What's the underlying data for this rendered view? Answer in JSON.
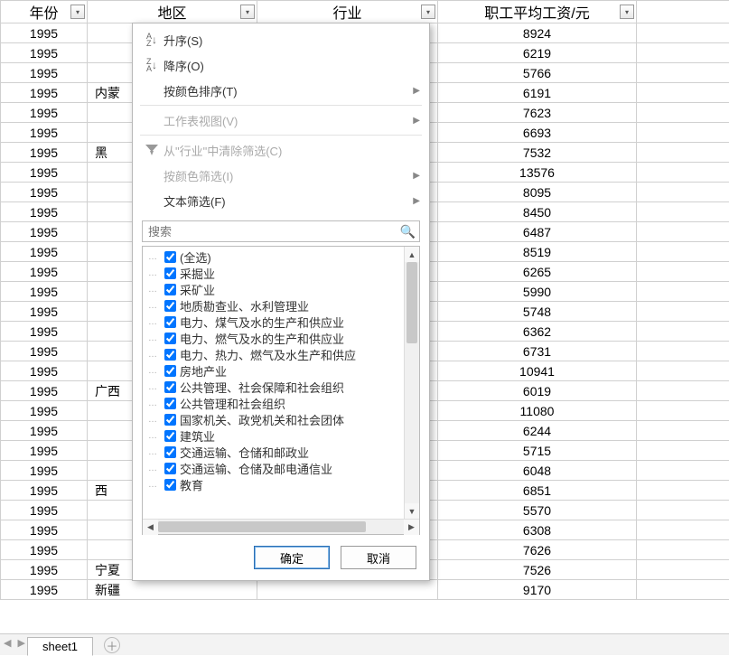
{
  "headers": {
    "year": "年份",
    "region": "地区",
    "industry": "行业",
    "salary": "职工平均工资/元"
  },
  "rows": [
    {
      "year": "1995",
      "region": "",
      "salary": "8924"
    },
    {
      "year": "1995",
      "region": "",
      "salary": "6219"
    },
    {
      "year": "1995",
      "region": "",
      "salary": "5766"
    },
    {
      "year": "1995",
      "region": "内蒙",
      "salary": "6191"
    },
    {
      "year": "1995",
      "region": "",
      "salary": "7623"
    },
    {
      "year": "1995",
      "region": "",
      "salary": "6693"
    },
    {
      "year": "1995",
      "region": "黑",
      "salary": "7532"
    },
    {
      "year": "1995",
      "region": "",
      "salary": "13576"
    },
    {
      "year": "1995",
      "region": "",
      "salary": "8095"
    },
    {
      "year": "1995",
      "region": "",
      "salary": "8450"
    },
    {
      "year": "1995",
      "region": "",
      "salary": "6487"
    },
    {
      "year": "1995",
      "region": "",
      "salary": "8519"
    },
    {
      "year": "1995",
      "region": "",
      "salary": "6265"
    },
    {
      "year": "1995",
      "region": "",
      "salary": "5990"
    },
    {
      "year": "1995",
      "region": "",
      "salary": "5748"
    },
    {
      "year": "1995",
      "region": "",
      "salary": "6362"
    },
    {
      "year": "1995",
      "region": "",
      "salary": "6731"
    },
    {
      "year": "1995",
      "region": "",
      "salary": "10941"
    },
    {
      "year": "1995",
      "region": "广西",
      "salary": "6019"
    },
    {
      "year": "1995",
      "region": "",
      "salary": "11080"
    },
    {
      "year": "1995",
      "region": "",
      "salary": "6244"
    },
    {
      "year": "1995",
      "region": "",
      "salary": "5715"
    },
    {
      "year": "1995",
      "region": "",
      "salary": "6048"
    },
    {
      "year": "1995",
      "region": "西",
      "salary": "6851"
    },
    {
      "year": "1995",
      "region": "",
      "salary": "5570"
    },
    {
      "year": "1995",
      "region": "",
      "salary": "6308"
    },
    {
      "year": "1995",
      "region": "",
      "salary": "7626"
    },
    {
      "year": "1995",
      "region": "宁夏",
      "salary": "7526"
    },
    {
      "year": "1995",
      "region": "新疆",
      "salary": "9170"
    }
  ],
  "dropdown": {
    "sort_asc": "升序(S)",
    "sort_desc": "降序(O)",
    "sort_by_color": "按颜色排序(T)",
    "sheet_view": "工作表视图(V)",
    "clear_filter": "从\"行业\"中清除筛选(C)",
    "filter_by_color": "按颜色筛选(I)",
    "text_filter": "文本筛选(F)",
    "search_placeholder": "搜索",
    "items": [
      "(全选)",
      "采掘业",
      "采矿业",
      "地质勘查业、水利管理业",
      "电力、煤气及水的生产和供应业",
      "电力、燃气及水的生产和供应业",
      "电力、热力、燃气及水生产和供应",
      "房地产业",
      "公共管理、社会保障和社会组织",
      "公共管理和社会组织",
      "国家机关、政党机关和社会团体",
      "建筑业",
      "交通运输、仓储和邮政业",
      "交通运输、仓储及邮电通信业",
      "教育"
    ],
    "ok": "确定",
    "cancel": "取消"
  },
  "tabs": {
    "sheet1": "sheet1"
  }
}
